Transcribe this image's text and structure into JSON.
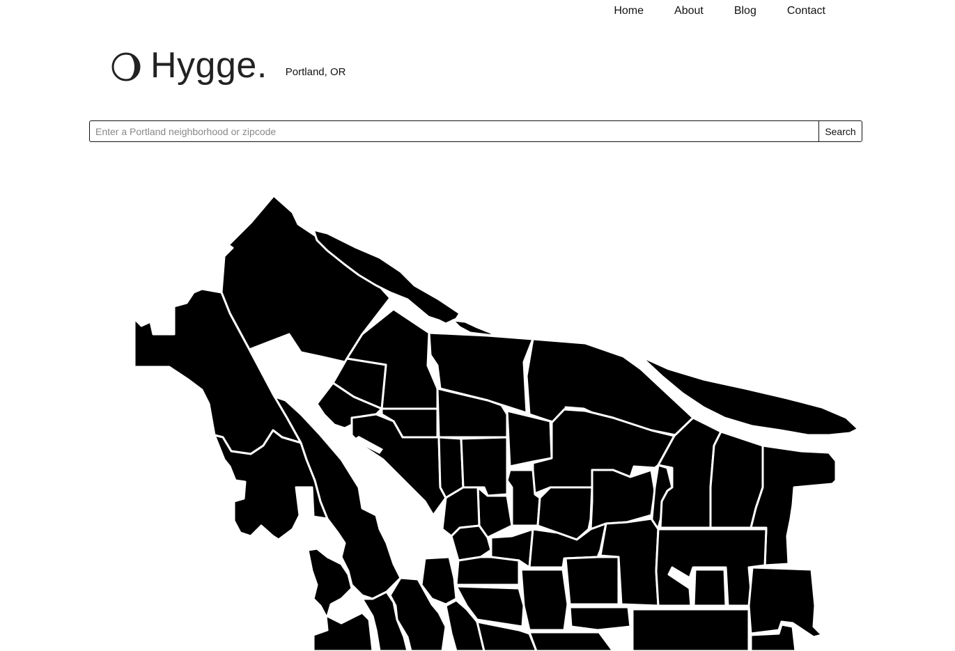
{
  "nav": {
    "items": [
      {
        "label": "Home"
      },
      {
        "label": "About"
      },
      {
        "label": "Blog"
      },
      {
        "label": "Contact"
      }
    ]
  },
  "brand": {
    "icon": "crescent-circle-icon",
    "title": "Hygge.",
    "subtitle": "Portland, OR"
  },
  "search": {
    "placeholder": "Enter a Portland neighborhood or zipcode",
    "value": "",
    "button_label": "Search"
  },
  "map": {
    "fill_color": "#000000",
    "border_color": "#ffffff"
  }
}
